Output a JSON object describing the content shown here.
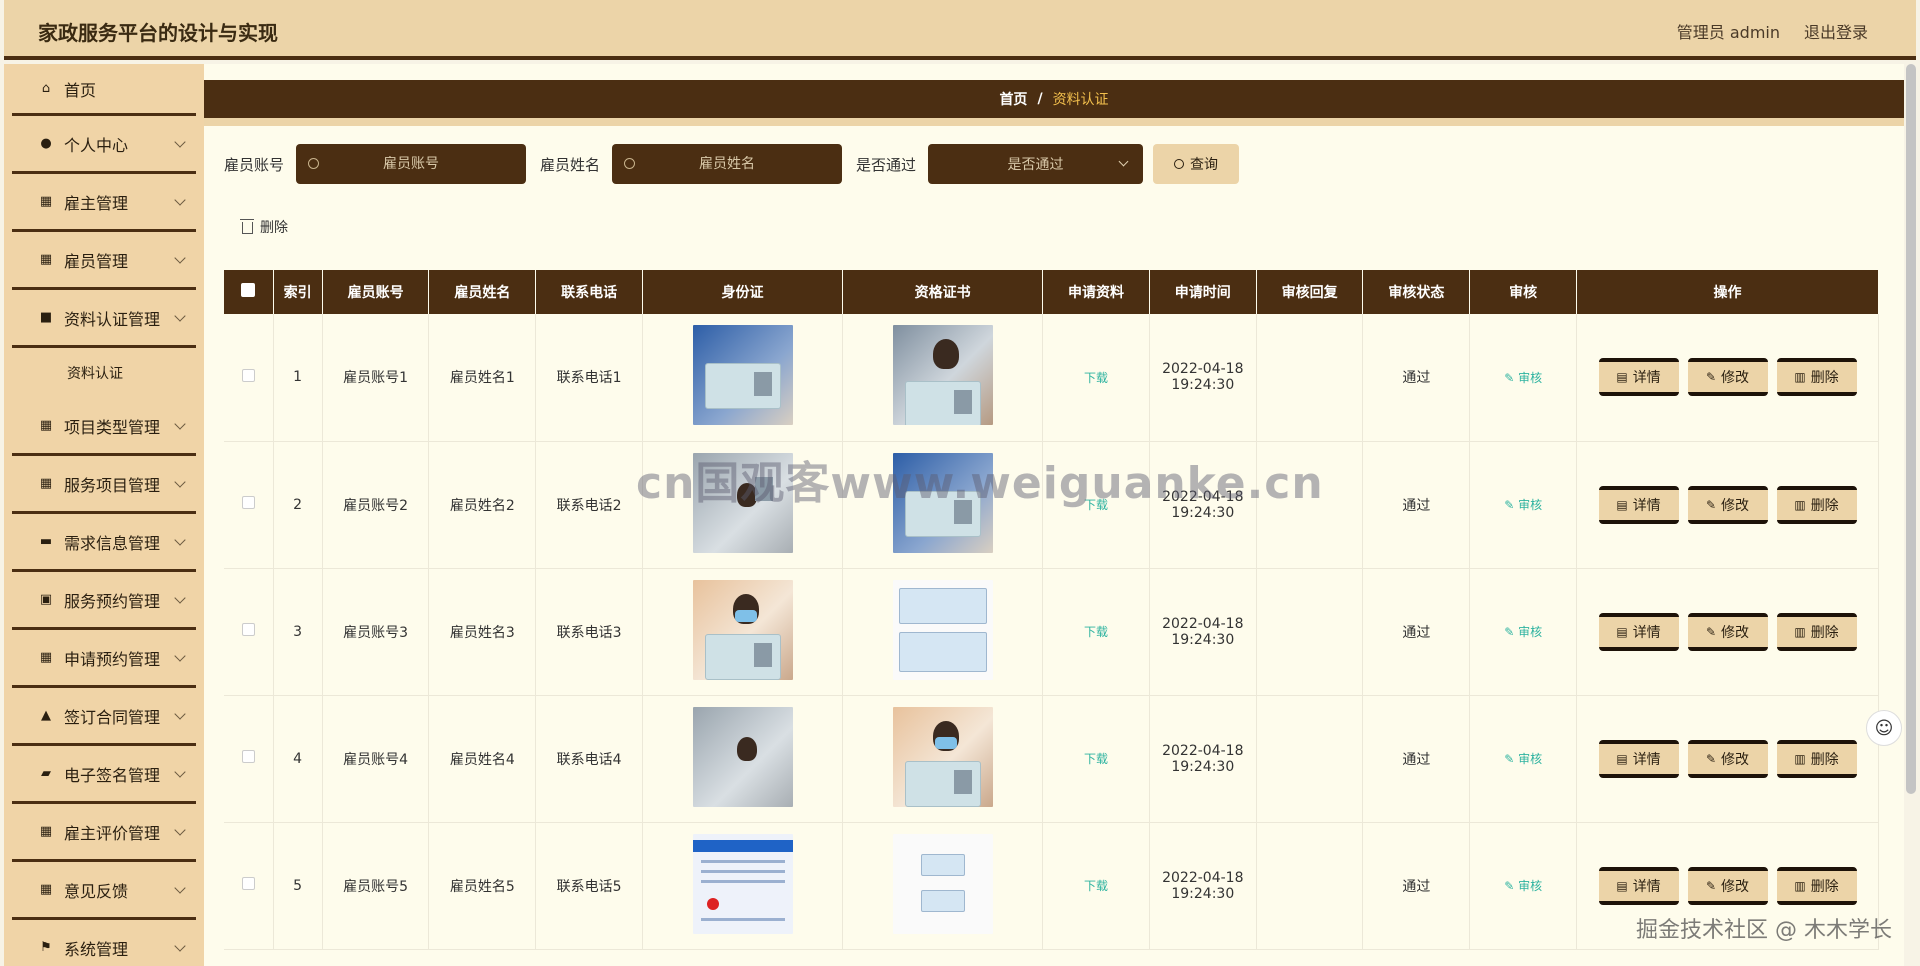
{
  "header": {
    "title": "家政服务平台的设计与实现",
    "admin": "管理员 admin",
    "logout": "退出登录"
  },
  "sidebar": {
    "items": [
      {
        "label": "首页",
        "icon": "home-icon"
      },
      {
        "label": "个人中心",
        "icon": "user-icon"
      },
      {
        "label": "雇主管理",
        "icon": "grid-icon"
      },
      {
        "label": "雇员管理",
        "icon": "grid-icon"
      },
      {
        "label": "资料认证管理",
        "icon": "briefcase-icon",
        "expanded": true
      },
      {
        "label": "资料认证",
        "submenu": true
      },
      {
        "label": "项目类型管理",
        "icon": "grid-icon"
      },
      {
        "label": "服务项目管理",
        "icon": "grid-icon"
      },
      {
        "label": "需求信息管理",
        "icon": "monitor-icon"
      },
      {
        "label": "服务预约管理",
        "icon": "clipboard-icon"
      },
      {
        "label": "申请预约管理",
        "icon": "grid-icon"
      },
      {
        "label": "签订合同管理",
        "icon": "person-icon"
      },
      {
        "label": "电子签名管理",
        "icon": "chat-icon"
      },
      {
        "label": "雇主评价管理",
        "icon": "grid-icon"
      },
      {
        "label": "意见反馈",
        "icon": "grid-icon"
      },
      {
        "label": "系统管理",
        "icon": "flag-icon"
      }
    ]
  },
  "breadcrumb": {
    "home": "首页",
    "sep": "/",
    "current": "资料认证"
  },
  "search": {
    "account_label": "雇员账号",
    "account_placeholder": "雇员账号",
    "name_label": "雇员姓名",
    "name_placeholder": "雇员姓名",
    "pass_label": "是否通过",
    "pass_placeholder": "是否通过",
    "query_label": "查询"
  },
  "actions": {
    "delete_label": "删除"
  },
  "table": {
    "headers": [
      "索引",
      "雇员账号",
      "雇员姓名",
      "联系电话",
      "身份证",
      "资格证书",
      "申请资料",
      "申请时间",
      "审核回复",
      "审核状态",
      "审核",
      "操作"
    ],
    "download_label": "下载",
    "audit_label": "审核",
    "op_labels": {
      "detail": "详情",
      "edit": "修改",
      "delete": "删除"
    },
    "rows": [
      {
        "index": "1",
        "account": "雇员账号1",
        "name": "雇员姓名1",
        "phone": "联系电话1",
        "date": "2022-04-18",
        "time": "19:24:30",
        "reply": "",
        "status": "通过",
        "id_img": "id-card-photo",
        "cert_img": "person-holding-card-photo"
      },
      {
        "index": "2",
        "account": "雇员账号2",
        "name": "雇员姓名2",
        "phone": "联系电话2",
        "date": "2022-04-18",
        "time": "19:24:30",
        "reply": "",
        "status": "通过",
        "id_img": "id-card-photo",
        "cert_img": "id-card-photo"
      },
      {
        "index": "3",
        "account": "雇员账号3",
        "name": "雇员姓名3",
        "phone": "联系电话3",
        "date": "2022-04-18",
        "time": "19:24:30",
        "reply": "",
        "status": "通过",
        "id_img": "person-holding-card-photo",
        "cert_img": "certificate-photo"
      },
      {
        "index": "4",
        "account": "雇员账号4",
        "name": "雇员姓名4",
        "phone": "联系电话4",
        "date": "2022-04-18",
        "time": "19:24:30",
        "reply": "",
        "status": "通过",
        "id_img": "id-card-photo",
        "cert_img": "person-holding-card-photo"
      },
      {
        "index": "5",
        "account": "雇员账号5",
        "name": "雇员姓名5",
        "phone": "联系电话5",
        "date": "2022-04-18",
        "time": "19:24:30",
        "reply": "",
        "status": "通过",
        "id_img": "document-photo",
        "cert_img": "id-card-pair-photo"
      }
    ]
  },
  "watermark": {
    "main": "cn国观客www.weiguanke.cn",
    "corner": "掘金技术社区 @ 木木学长"
  },
  "colors": {
    "brown": "#4b2e12",
    "tan": "#ecd4a8",
    "accent": "#f3c04d",
    "link": "#2eb3a0"
  }
}
